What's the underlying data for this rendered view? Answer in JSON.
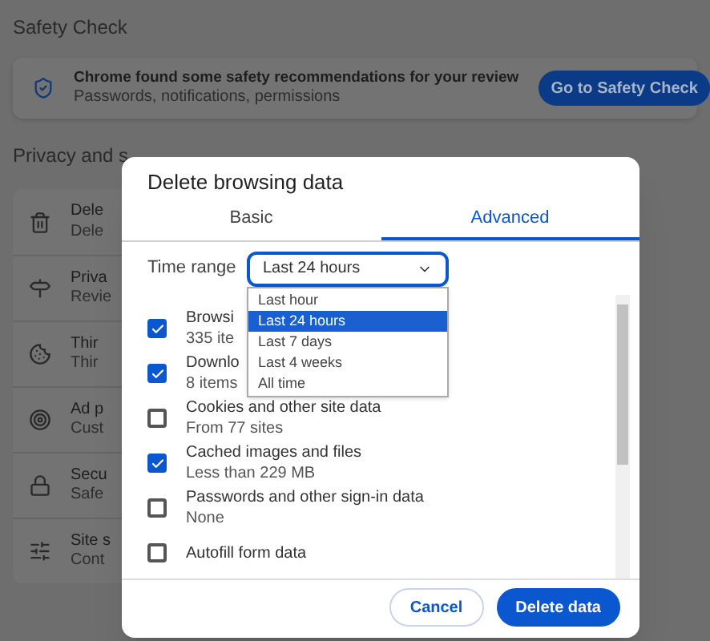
{
  "safety_check": {
    "heading": "Safety Check",
    "title": "Chrome found some safety recommendations for your review",
    "subtitle": "Passwords, notifications, permissions",
    "button": "Go to Safety Check"
  },
  "privacy": {
    "heading": "Privacy and s",
    "items": [
      {
        "title": "Dele",
        "subtitle": "Dele"
      },
      {
        "title": "Priva",
        "subtitle": "Revie"
      },
      {
        "title": "Thir",
        "subtitle": "Thir"
      },
      {
        "title": "Ad p",
        "subtitle": "Cust"
      },
      {
        "title": "Secu",
        "subtitle": "Safe"
      },
      {
        "title": "Site s",
        "subtitle": "Cont"
      }
    ]
  },
  "dialog": {
    "title": "Delete browsing data",
    "tabs": [
      {
        "label": "Basic",
        "selected": false
      },
      {
        "label": "Advanced",
        "selected": true
      }
    ],
    "time_range": {
      "label": "Time range",
      "value": "Last 24 hours",
      "expanded": true,
      "options": [
        {
          "label": "Last hour",
          "selected": false
        },
        {
          "label": "Last 24 hours",
          "selected": true
        },
        {
          "label": "Last 7 days",
          "selected": false
        },
        {
          "label": "Last 4 weeks",
          "selected": false
        },
        {
          "label": "All time",
          "selected": false
        }
      ]
    },
    "items": [
      {
        "title": "Browsi",
        "subtitle": "335 ite",
        "checked": true
      },
      {
        "title": "Downlo",
        "subtitle": "8 items",
        "checked": true
      },
      {
        "title": "Cookies and other site data",
        "subtitle": "From 77 sites",
        "checked": false
      },
      {
        "title": "Cached images and files",
        "subtitle": "Less than 229 MB",
        "checked": true
      },
      {
        "title": "Passwords and other sign-in data",
        "subtitle": "None",
        "checked": false
      },
      {
        "title": "Autofill form data",
        "checked": false
      }
    ],
    "buttons": {
      "cancel": "Cancel",
      "confirm": "Delete data"
    }
  }
}
